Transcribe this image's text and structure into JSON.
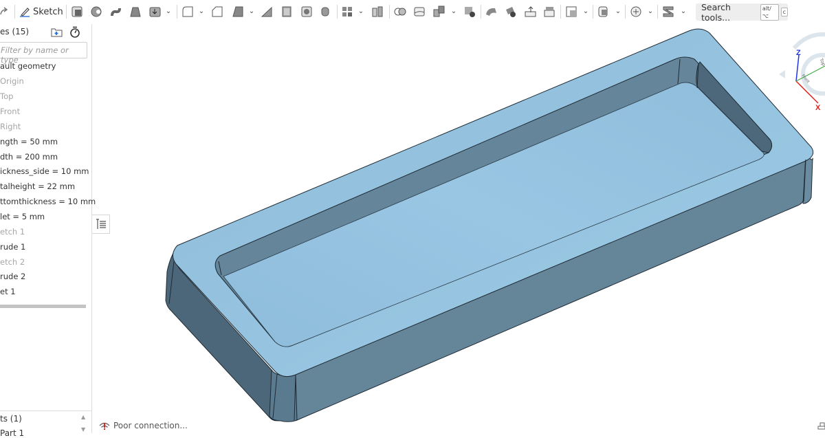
{
  "toolbar": {
    "sketch_label": "Sketch",
    "search_placeholder": "Search tools...",
    "search_shortcut_1": "alt/⌥",
    "search_shortcut_2": "c",
    "icons": [
      "redo-icon",
      "sketch-icon",
      "extrude-icon",
      "revolve-icon",
      "sweep-icon",
      "loft-icon",
      "thicken-icon",
      "fillet-icon",
      "chamfer-icon",
      "draft-icon",
      "rib-icon",
      "shell-icon",
      "hole-icon",
      "cylinder-icon",
      "linear-pattern-icon",
      "mirror-icon",
      "boolean-icon",
      "split-icon",
      "transform-icon",
      "delete-part-icon",
      "modify-fillet-icon",
      "delete-face-icon",
      "move-face-icon",
      "replace-face-icon",
      "plane-icon",
      "helix-icon",
      "mate-connector-icon",
      "sheet-metal-icon"
    ]
  },
  "feature_panel": {
    "title": "es (15)",
    "filter_placeholder": "Filter by name or type",
    "items": [
      {
        "label": "ault geometry",
        "dim": false
      },
      {
        "label": "Origin",
        "dim": true
      },
      {
        "label": "Top",
        "dim": true
      },
      {
        "label": "Front",
        "dim": true
      },
      {
        "label": "Right",
        "dim": true
      },
      {
        "label": "ngth = 50 mm",
        "dim": false
      },
      {
        "label": "dth = 200 mm",
        "dim": false
      },
      {
        "label": "ickness_side = 10 mm",
        "dim": false
      },
      {
        "label": "talheight = 22 mm",
        "dim": false
      },
      {
        "label": "ttomthickness = 10 mm",
        "dim": false
      },
      {
        "label": "let = 5 mm",
        "dim": false
      },
      {
        "label": "etch 1",
        "dim": true
      },
      {
        "label": "rude 1",
        "dim": false
      },
      {
        "label": "etch 2",
        "dim": true
      },
      {
        "label": "rude 2",
        "dim": false
      },
      {
        "label": "et 1",
        "dim": false
      }
    ],
    "parts_title": "ts (1)",
    "parts_item": "Part 1"
  },
  "status": {
    "connection_text": "Poor connection..."
  },
  "view_cube": {
    "z_label": "Z",
    "x_label": "X",
    "front_label": "Front",
    "top_label": "Top"
  },
  "colors": {
    "top_face": "#93c1de",
    "side_face": "#64869c",
    "dark_side": "#4b6476",
    "edge": "#1e2a33",
    "axis_z": "#2233dd",
    "axis_x": "#dd2222",
    "axis_y": "#44aa44"
  }
}
